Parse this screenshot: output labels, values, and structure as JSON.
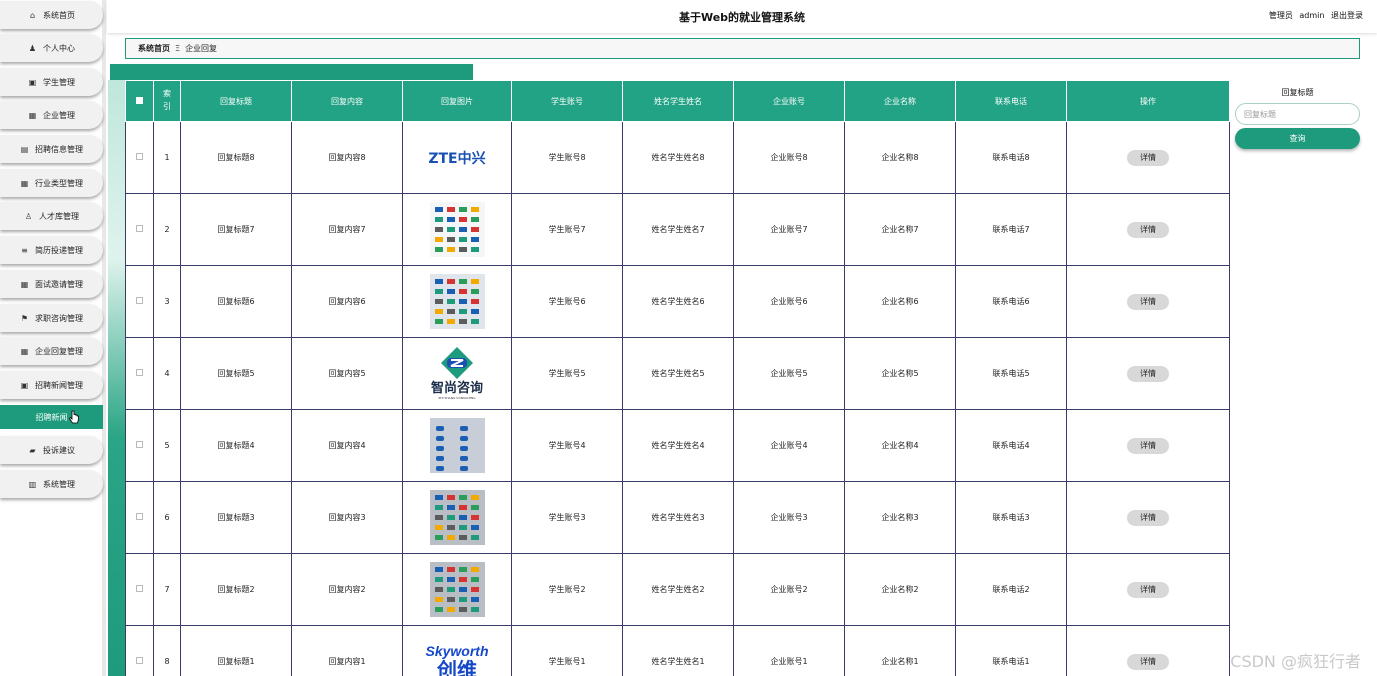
{
  "header": {
    "title": "基于Web的就业管理系统",
    "user_role": "管理员",
    "username": "admin",
    "logout": "退出登录"
  },
  "sidebar": {
    "items": [
      {
        "label": "系统首页",
        "icon": "home-icon"
      },
      {
        "label": "个人中心",
        "icon": "user-icon"
      },
      {
        "label": "学生管理",
        "icon": "box-icon"
      },
      {
        "label": "企业管理",
        "icon": "grid-icon"
      },
      {
        "label": "招聘信息管理",
        "icon": "doc-icon"
      },
      {
        "label": "行业类型管理",
        "icon": "grid-icon"
      },
      {
        "label": "人才库管理",
        "icon": "pin-icon"
      },
      {
        "label": "简历投递管理",
        "icon": "list-icon"
      },
      {
        "label": "面试邀请管理",
        "icon": "grid-icon"
      },
      {
        "label": "求职咨询管理",
        "icon": "flag-icon"
      },
      {
        "label": "企业回复管理",
        "icon": "grid-icon"
      },
      {
        "label": "招聘新闻管理",
        "icon": "box-icon"
      },
      {
        "label": "招聘新闻",
        "icon": "",
        "active": true
      },
      {
        "label": "投诉建议",
        "icon": "chat-icon"
      },
      {
        "label": "系统管理",
        "icon": "db-icon"
      }
    ]
  },
  "breadcrumb": {
    "home": "系统首页",
    "separator": "Ξ",
    "current": "企业回复"
  },
  "table": {
    "columns": [
      "索引",
      "回复标题",
      "回复内容",
      "回复图片",
      "学生账号",
      "姓名学生姓名",
      "企业账号",
      "企业名称",
      "联系电话",
      "操作"
    ],
    "action_label": "详情",
    "rows": [
      {
        "index": "1",
        "title": "回复标题8",
        "content": "回复内容8",
        "image": "zte-logo",
        "image_text": "ZTE中兴",
        "student_account": "学生账号8",
        "student_name": "姓名学生姓名8",
        "company_account": "企业账号8",
        "company_name": "企业名称8",
        "phone": "联系电话8"
      },
      {
        "index": "2",
        "title": "回复标题7",
        "content": "回复内容7",
        "image": "logo-grid-image",
        "image_text": "",
        "student_account": "学生账号7",
        "student_name": "姓名学生姓名7",
        "company_account": "企业账号7",
        "company_name": "企业名称7",
        "phone": "联系电话7"
      },
      {
        "index": "3",
        "title": "回复标题6",
        "content": "回复内容6",
        "image": "logo-wall-image",
        "image_text": "",
        "student_account": "学生账号6",
        "student_name": "姓名学生姓名6",
        "company_account": "企业账号6",
        "company_name": "企业名称6",
        "phone": "联系电话6"
      },
      {
        "index": "4",
        "title": "回复标题5",
        "content": "回复内容5",
        "image": "zhishang-logo",
        "image_text": "智尚咨询",
        "image_subtext": "ZHI SHANG CONSULTING",
        "student_account": "学生账号5",
        "student_name": "姓名学生姓名5",
        "company_account": "企业账号5",
        "company_name": "企业名称5",
        "phone": "联系电话5"
      },
      {
        "index": "5",
        "title": "回复标题4",
        "content": "回复内容4",
        "image": "blue-logo-image",
        "image_text": "",
        "student_account": "学生账号4",
        "student_name": "姓名学生姓名4",
        "company_account": "企业账号4",
        "company_name": "企业名称4",
        "phone": "联系电话4"
      },
      {
        "index": "6",
        "title": "回复标题3",
        "content": "回复内容3",
        "image": "logo-sheet-image",
        "image_text": "",
        "student_account": "学生账号3",
        "student_name": "姓名学生姓名3",
        "company_account": "企业账号3",
        "company_name": "企业名称3",
        "phone": "联系电话3"
      },
      {
        "index": "7",
        "title": "回复标题2",
        "content": "回复内容2",
        "image": "logo-sheet-image",
        "image_text": "",
        "student_account": "学生账号2",
        "student_name": "姓名学生姓名2",
        "company_account": "企业账号2",
        "company_name": "企业名称2",
        "phone": "联系电话2"
      },
      {
        "index": "8",
        "title": "回复标题1",
        "content": "回复内容1",
        "image": "skyworth-logo",
        "image_text": "Skyworth",
        "image_subtext": "创维",
        "student_account": "学生账号1",
        "student_name": "姓名学生姓名1",
        "company_account": "企业账号1",
        "company_name": "企业名称1",
        "phone": "联系电话1"
      }
    ]
  },
  "search": {
    "label": "回复标题",
    "placeholder": "回复标题",
    "button": "查询"
  },
  "watermark": "CSDN @疯狂行者",
  "colors": {
    "accent": "#1e9b7d",
    "header_row": "#23a385",
    "button_gray": "#d8d8d8"
  }
}
